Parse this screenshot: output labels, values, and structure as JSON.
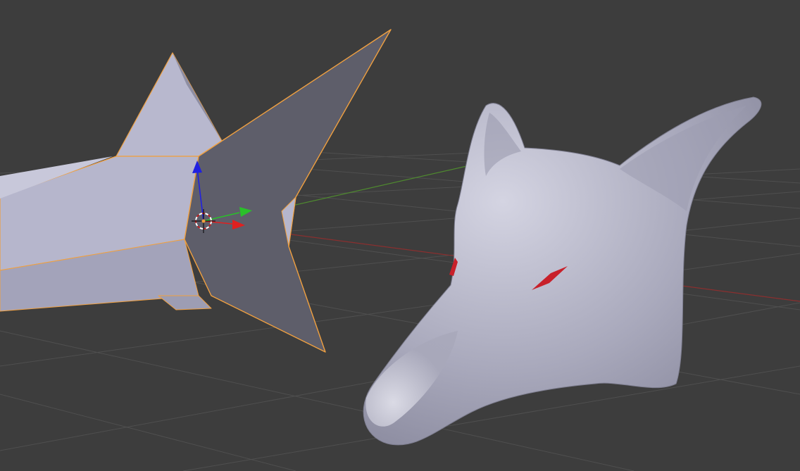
{
  "viewport": {
    "background": "#3d3d3d"
  },
  "colors": {
    "grid_line": "#4f4f4f",
    "x_axis": "#8a2f2f",
    "y_axis": "#4f8a2f",
    "selected_outline": "#f0a040",
    "lowpoly_light": "#b6b6cc",
    "lowpoly_mid": "#9d9db3",
    "lowpoly_dark": "#5e5e6a",
    "smooth_mesh": "#aeaec0",
    "eye_red": "#c8202a",
    "gizmo_x": "#e02020",
    "gizmo_y": "#2ac02a",
    "gizmo_z": "#2020e0",
    "cursor": "#ffffff"
  },
  "objects": [
    {
      "name": "lowpoly-fox-head",
      "selected": true
    },
    {
      "name": "subdivided-fox-head",
      "selected": false
    }
  ],
  "icons": {
    "cursor": "3d-cursor-icon",
    "gizmo": "transform-gizmo-icon"
  }
}
